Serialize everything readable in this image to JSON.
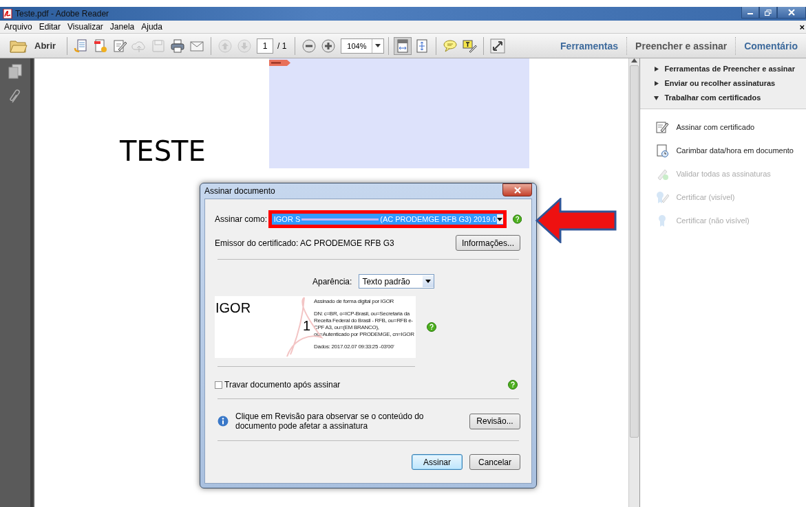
{
  "window": {
    "title": "Teste.pdf - Adobe Reader"
  },
  "menu": [
    {
      "label": "Arquivo"
    },
    {
      "label": "Editar"
    },
    {
      "label": "Visualizar"
    },
    {
      "label": "Janela"
    },
    {
      "label": "Ajuda"
    }
  ],
  "menu_close": "×",
  "toolbar": {
    "items": [
      {
        "kind": "open",
        "label": "Abrir"
      },
      {
        "kind": "separator"
      },
      {
        "kind": "icon",
        "disabled": false,
        "selected": false
      },
      {
        "kind": "icon",
        "disabled": false,
        "selected": false
      },
      {
        "kind": "icon",
        "disabled": false,
        "selected": false
      },
      {
        "kind": "icon",
        "disabled": true,
        "selected": false
      },
      {
        "kind": "icon",
        "disabled": true,
        "selected": false
      },
      {
        "kind": "icon",
        "disabled": false,
        "selected": false
      },
      {
        "kind": "icon",
        "disabled": false,
        "selected": false
      },
      {
        "kind": "separator"
      },
      {
        "kind": "icon",
        "disabled": true,
        "selected": false
      },
      {
        "kind": "icon",
        "disabled": true,
        "selected": false
      },
      {
        "kind": "page",
        "value": "1",
        "total": "/ 1"
      },
      {
        "kind": "separator"
      },
      {
        "kind": "icon",
        "disabled": false,
        "selected": false
      },
      {
        "kind": "icon",
        "disabled": false,
        "selected": false
      },
      {
        "kind": "zoom",
        "value": "104%"
      },
      {
        "kind": "separator"
      },
      {
        "kind": "icon",
        "disabled": false,
        "selected": true
      },
      {
        "kind": "icon",
        "disabled": false,
        "selected": false
      },
      {
        "kind": "separator"
      },
      {
        "kind": "icon",
        "disabled": false,
        "selected": false
      },
      {
        "kind": "icon",
        "disabled": false,
        "selected": false
      },
      {
        "kind": "separator"
      },
      {
        "kind": "icon",
        "disabled": false,
        "selected": false
      }
    ]
  },
  "tabs": [
    {
      "label": "Ferramentas",
      "selected": false
    },
    {
      "label": "Preencher e assinar",
      "selected": true
    },
    {
      "label": "Comentário",
      "selected": false
    }
  ],
  "document": {
    "heading": "TESTE"
  },
  "right_pane": {
    "sections": [
      {
        "label": "Ferramentas de Preencher e assinar",
        "expanded": false
      },
      {
        "label": "Enviar ou recolher assinaturas",
        "expanded": false
      },
      {
        "label": "Trabalhar com certificados",
        "expanded": true
      }
    ],
    "tools": [
      {
        "label": "Assinar com certificado",
        "disabled": false
      },
      {
        "label": "Carimbar data/hora em documento",
        "disabled": false
      },
      {
        "label": "Validar todas as assinaturas",
        "disabled": true
      },
      {
        "label": "Certificar (visível)",
        "disabled": true
      },
      {
        "label": "Certificar (não visível)",
        "disabled": true
      }
    ]
  },
  "dialog": {
    "title": "Assinar documento",
    "sign_as": {
      "label": "Assinar como:",
      "value_start": "IGOR S",
      "value_end": "(AC PRODEMGE RFB G3) 2019.0"
    },
    "issuer": "Emissor do certificado: AC PRODEMGE RFB G3",
    "info_button": "Informações...",
    "appearance": {
      "label": "Aparência:",
      "value": "Texto padrão"
    },
    "preview": {
      "name": "IGOR",
      "number": "1",
      "lines": [
        "Assinado de forma digital por IGOR",
        "DN: c=BR, o=ICP-Brasil, ou=Secretaria da Receita Federal do Brasil - RFB, ou=RFB e-CPF A3, ou=(EM BRANCO), ou=Autenticado por PRODEMGE, cn=IGOR",
        "Dados: 2017.02.07 09:33:25 -03'00'"
      ]
    },
    "lock": {
      "label": "Travar documento após assinar",
      "checked": false
    },
    "review": {
      "text": "Clique em Revisão para observar se o conteúdo do documento pode afetar a assinatura",
      "button": "Revisão..."
    },
    "buttons": [
      {
        "label": "Assinar",
        "default": true
      },
      {
        "label": "Cancelar",
        "default": false
      }
    ]
  }
}
